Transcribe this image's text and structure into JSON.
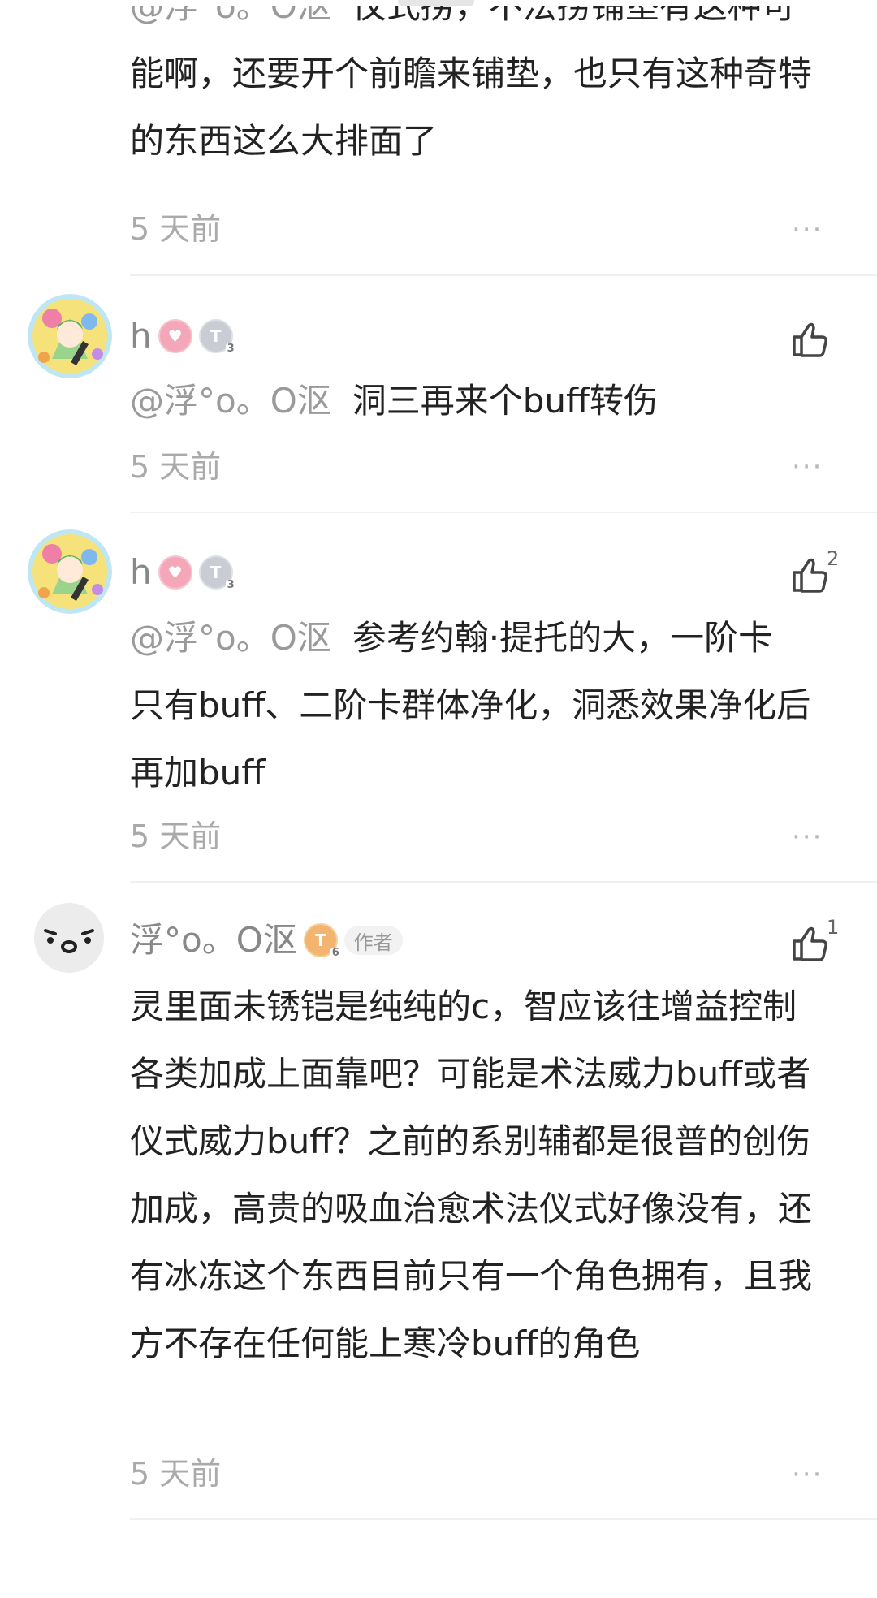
{
  "comments": [
    {
      "mention": "@浮°o。O沤",
      "text": "仪式捞，不法捞铺垫有这种可能啊，还要开个前瞻来铺垫，也只有这种奇特的东西这么大排面了",
      "time": "5 天前",
      "more": "···"
    },
    {
      "name": "h",
      "avatar": "anime-avatar",
      "badge_level": "3",
      "mention": "@浮°o。O沤",
      "text": "洞三再来个buff转伤",
      "time": "5 天前",
      "likes": "",
      "more": "···"
    },
    {
      "name": "h",
      "avatar": "anime-avatar",
      "badge_level": "3",
      "mention": "@浮°o。O沤",
      "text_line1": "参考约翰·提托的大，一阶卡",
      "text_rest": "只有buff、二阶卡群体净化，洞悉效果净化后再加buff",
      "time": "5 天前",
      "likes": "2",
      "more": "···"
    },
    {
      "name": "浮°o。O沤",
      "avatar": "face-avatar",
      "badge_level": "6",
      "author_tag": "作者",
      "text": "灵里面未锈铠是纯纯的c，智应该往增益控制各类加成上面靠吧？可能是术法威力buff或者仪式威力buff？之前的系别辅都是很普的创伤加成，高贵的吸血治愈术法仪式好像没有，还有冰冻这个东西目前只有一个角色拥有，且我方不存在任何能上寒冷buff的角色",
      "time": "5 天前",
      "likes": "1",
      "more": "···"
    }
  ],
  "colors": {
    "text": "#222222",
    "secondary": "#9a9a9a",
    "time": "#aaaaaa",
    "divider": "#f0f0f0"
  }
}
